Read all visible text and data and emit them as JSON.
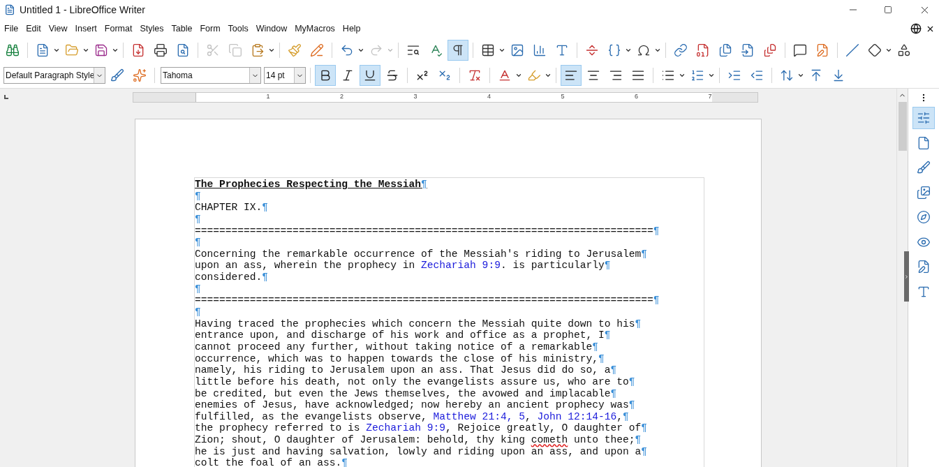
{
  "window": {
    "title": "Untitled 1 - LibreOffice Writer"
  },
  "menu": [
    "File",
    "Edit",
    "View",
    "Insert",
    "Format",
    "Styles",
    "Table",
    "Form",
    "Tools",
    "Window",
    "MyMacros",
    "Help"
  ],
  "toolbars": [
    {
      "items": [
        {
          "kind": "button",
          "dropdown": false,
          "selected": false,
          "disabled": false
        },
        {
          "kind": "separator"
        },
        {
          "kind": "button",
          "dropdown": true,
          "selected": false,
          "disabled": false
        },
        {
          "kind": "button",
          "dropdown": true,
          "selected": false,
          "disabled": false
        },
        {
          "kind": "button",
          "dropdown": true,
          "selected": false,
          "disabled": false
        },
        {
          "kind": "separator"
        },
        {
          "kind": "button",
          "dropdown": false,
          "selected": false,
          "disabled": false
        },
        {
          "kind": "button",
          "dropdown": false,
          "selected": false,
          "disabled": false
        },
        {
          "kind": "button",
          "dropdown": false,
          "selected": false,
          "disabled": false
        },
        {
          "kind": "separator"
        },
        {
          "kind": "button",
          "dropdown": false,
          "selected": false,
          "disabled": true
        },
        {
          "kind": "button",
          "dropdown": false,
          "selected": false,
          "disabled": true
        },
        {
          "kind": "button",
          "dropdown": true,
          "selected": false,
          "disabled": false
        },
        {
          "kind": "separator"
        },
        {
          "kind": "button",
          "dropdown": false,
          "selected": false,
          "disabled": false
        },
        {
          "kind": "button",
          "dropdown": false,
          "selected": false,
          "disabled": false
        },
        {
          "kind": "separator"
        },
        {
          "kind": "button",
          "dropdown": true,
          "selected": false,
          "disabled": false
        },
        {
          "kind": "button",
          "dropdown": true,
          "selected": false,
          "disabled": true
        },
        {
          "kind": "separator"
        },
        {
          "kind": "button",
          "dropdown": false,
          "selected": false,
          "disabled": false
        },
        {
          "kind": "button",
          "dropdown": false,
          "selected": false,
          "disabled": false
        },
        {
          "kind": "button",
          "dropdown": false,
          "selected": true,
          "disabled": false
        },
        {
          "kind": "separator"
        },
        {
          "kind": "button",
          "dropdown": true,
          "selected": false,
          "disabled": false
        },
        {
          "kind": "button",
          "dropdown": false,
          "selected": false,
          "disabled": false
        },
        {
          "kind": "button",
          "dropdown": false,
          "selected": false,
          "disabled": false
        },
        {
          "kind": "button",
          "dropdown": false,
          "selected": false,
          "disabled": false
        },
        {
          "kind": "separator"
        },
        {
          "kind": "button",
          "dropdown": false,
          "selected": false,
          "disabled": false
        },
        {
          "kind": "button",
          "dropdown": true,
          "selected": false,
          "disabled": false
        },
        {
          "kind": "button",
          "dropdown": true,
          "selected": false,
          "disabled": false
        },
        {
          "kind": "separator"
        },
        {
          "kind": "button",
          "dropdown": false,
          "selected": false,
          "disabled": false
        },
        {
          "kind": "button",
          "dropdown": false,
          "selected": false,
          "disabled": false
        },
        {
          "kind": "button",
          "dropdown": false,
          "selected": false,
          "disabled": false
        },
        {
          "kind": "button",
          "dropdown": false,
          "selected": false,
          "disabled": false
        },
        {
          "kind": "button",
          "dropdown": false,
          "selected": false,
          "disabled": false
        },
        {
          "kind": "separator"
        },
        {
          "kind": "button",
          "dropdown": false,
          "selected": false,
          "disabled": false
        },
        {
          "kind": "button",
          "dropdown": false,
          "selected": false,
          "disabled": false
        },
        {
          "kind": "separator"
        },
        {
          "kind": "button",
          "dropdown": false,
          "selected": false,
          "disabled": false
        },
        {
          "kind": "button",
          "dropdown": true,
          "selected": false,
          "disabled": false
        },
        {
          "kind": "button",
          "dropdown": false,
          "selected": false,
          "disabled": false
        }
      ]
    },
    {
      "items": [
        {
          "kind": "combo",
          "value": "Default Paragraph Style"
        },
        {
          "kind": "button",
          "dropdown": false,
          "selected": false,
          "disabled": false
        },
        {
          "kind": "button",
          "dropdown": false,
          "selected": false,
          "disabled": false
        },
        {
          "kind": "separator"
        },
        {
          "kind": "combo",
          "value": "Tahoma"
        },
        {
          "kind": "combo",
          "value": "14 pt"
        },
        {
          "kind": "separator"
        },
        {
          "kind": "button",
          "dropdown": false,
          "selected": true,
          "disabled": false
        },
        {
          "kind": "button",
          "dropdown": false,
          "selected": false,
          "disabled": false
        },
        {
          "kind": "button",
          "dropdown": false,
          "selected": true,
          "disabled": false
        },
        {
          "kind": "button",
          "dropdown": false,
          "selected": false,
          "disabled": false
        },
        {
          "kind": "separator"
        },
        {
          "kind": "button",
          "dropdown": false,
          "selected": false,
          "disabled": false
        },
        {
          "kind": "button",
          "dropdown": false,
          "selected": false,
          "disabled": false
        },
        {
          "kind": "separator"
        },
        {
          "kind": "button",
          "dropdown": false,
          "selected": false,
          "disabled": false
        },
        {
          "kind": "separator"
        },
        {
          "kind": "button",
          "dropdown": true,
          "selected": false,
          "disabled": false
        },
        {
          "kind": "button",
          "dropdown": true,
          "selected": false,
          "disabled": false
        },
        {
          "kind": "separator"
        },
        {
          "kind": "button",
          "dropdown": false,
          "selected": true,
          "disabled": false
        },
        {
          "kind": "button",
          "dropdown": false,
          "selected": false,
          "disabled": false
        },
        {
          "kind": "button",
          "dropdown": false,
          "selected": false,
          "disabled": false
        },
        {
          "kind": "button",
          "dropdown": false,
          "selected": false,
          "disabled": false
        },
        {
          "kind": "separator"
        },
        {
          "kind": "button",
          "dropdown": true,
          "selected": false,
          "disabled": false
        },
        {
          "kind": "button",
          "dropdown": true,
          "selected": false,
          "disabled": false
        },
        {
          "kind": "separator"
        },
        {
          "kind": "button",
          "dropdown": false,
          "selected": false,
          "disabled": false
        },
        {
          "kind": "button",
          "dropdown": false,
          "selected": false,
          "disabled": false
        },
        {
          "kind": "separator"
        },
        {
          "kind": "button",
          "dropdown": true,
          "selected": false,
          "disabled": false
        },
        {
          "kind": "button",
          "dropdown": false,
          "selected": false,
          "disabled": false
        },
        {
          "kind": "button",
          "dropdown": false,
          "selected": false,
          "disabled": false
        }
      ]
    }
  ],
  "ruler": {
    "labels": [
      "1",
      "2",
      "3",
      "4",
      "5",
      "6",
      "7"
    ]
  },
  "document": {
    "lines": [
      {
        "kind": "heading",
        "segments": [
          {
            "kind": "plain",
            "text": "The Prophecies Respecting the Messiah"
          }
        ],
        "mark": "¶"
      },
      {
        "kind": "body",
        "mark": "¶"
      },
      {
        "kind": "body",
        "segments": [
          {
            "kind": "plain",
            "text": "CHAPTER IX."
          }
        ],
        "mark": "¶"
      },
      {
        "kind": "body",
        "mark": "¶"
      },
      {
        "kind": "body",
        "segments": [
          {
            "kind": "plain",
            "text": "==========================================================================="
          }
        ],
        "mark": "¶"
      },
      {
        "kind": "body",
        "mark": "¶"
      },
      {
        "kind": "body",
        "segments": [
          {
            "kind": "plain",
            "text": "Concerning the remarkable occurrence of the Messiah's riding to Jerusalem"
          }
        ],
        "mark": "¶"
      },
      {
        "kind": "body",
        "segments": [
          {
            "kind": "plain",
            "text": "upon an ass, wherein the prophecy in "
          },
          {
            "kind": "link",
            "text": "Zechariah 9:9"
          },
          {
            "kind": "plain",
            "text": ". is particularly"
          }
        ],
        "mark": "¶"
      },
      {
        "kind": "body",
        "segments": [
          {
            "kind": "plain",
            "text": "considered."
          }
        ],
        "mark": "¶"
      },
      {
        "kind": "body",
        "mark": "¶"
      },
      {
        "kind": "body",
        "segments": [
          {
            "kind": "plain",
            "text": "==========================================================================="
          }
        ],
        "mark": "¶"
      },
      {
        "kind": "body",
        "mark": "¶"
      },
      {
        "kind": "body",
        "segments": [
          {
            "kind": "plain",
            "text": "Having traced the prophecies which concern the Messiah quite down to his"
          }
        ],
        "mark": "¶"
      },
      {
        "kind": "body",
        "segments": [
          {
            "kind": "plain",
            "text": "entrance upon, and discharge of his work and office as a prophet, I"
          }
        ],
        "mark": "¶"
      },
      {
        "kind": "body",
        "segments": [
          {
            "kind": "plain",
            "text": "cannot proceed any further, without taking notice of a remarkable"
          }
        ],
        "mark": "¶"
      },
      {
        "kind": "body",
        "segments": [
          {
            "kind": "plain",
            "text": "occurrence, which was to happen towards the close of his ministry,"
          }
        ],
        "mark": "¶"
      },
      {
        "kind": "body",
        "segments": [
          {
            "kind": "plain",
            "text": "namely, his riding to Jerusalem upon an ass. That Jesus did do so, a"
          }
        ],
        "mark": "¶"
      },
      {
        "kind": "body",
        "segments": [
          {
            "kind": "plain",
            "text": "little before his death, not only the evangelists assure us, who are to"
          }
        ],
        "mark": "¶"
      },
      {
        "kind": "body",
        "segments": [
          {
            "kind": "plain",
            "text": "be credited, but even the Jews themselves, the avowed and implacable"
          }
        ],
        "mark": "¶"
      },
      {
        "kind": "body",
        "segments": [
          {
            "kind": "plain",
            "text": "enemies of Jesus, have acknowledged; now hereby an ancient prophecy was"
          }
        ],
        "mark": "¶"
      },
      {
        "kind": "body",
        "segments": [
          {
            "kind": "plain",
            "text": "fulfilled, as the evangelists observe, "
          },
          {
            "kind": "link",
            "text": "Matthew 21:4, 5"
          },
          {
            "kind": "plain",
            "text": ", "
          },
          {
            "kind": "link",
            "text": "John 12:14-16"
          },
          {
            "kind": "plain",
            "text": ","
          }
        ],
        "mark": "¶"
      },
      {
        "kind": "body",
        "segments": [
          {
            "kind": "plain",
            "text": "the prophecy referred to is "
          },
          {
            "kind": "link",
            "text": "Zechariah 9:9"
          },
          {
            "kind": "plain",
            "text": ", Rejoice greatly, O daughter of"
          }
        ],
        "mark": "¶"
      },
      {
        "kind": "body",
        "segments": [
          {
            "kind": "plain",
            "text": "Zion; shout, O daughter of Jerusalem: behold, thy king "
          },
          {
            "kind": "misspelled",
            "text": "cometh"
          },
          {
            "kind": "plain",
            "text": " unto thee;"
          }
        ],
        "mark": "¶"
      },
      {
        "kind": "body",
        "segments": [
          {
            "kind": "plain",
            "text": "he is just and having salvation, lowly and riding upon an ass, and upon a"
          }
        ],
        "mark": "¶"
      },
      {
        "kind": "body",
        "segments": [
          {
            "kind": "plain",
            "text": "colt the foal of an ass."
          }
        ],
        "mark": "¶"
      }
    ]
  },
  "sidebar": {
    "items": [
      {
        "selected": true
      },
      {
        "selected": false
      },
      {
        "selected": false
      },
      {
        "selected": false
      },
      {
        "selected": false
      },
      {
        "selected": false
      },
      {
        "selected": false
      },
      {
        "selected": false
      }
    ]
  }
}
